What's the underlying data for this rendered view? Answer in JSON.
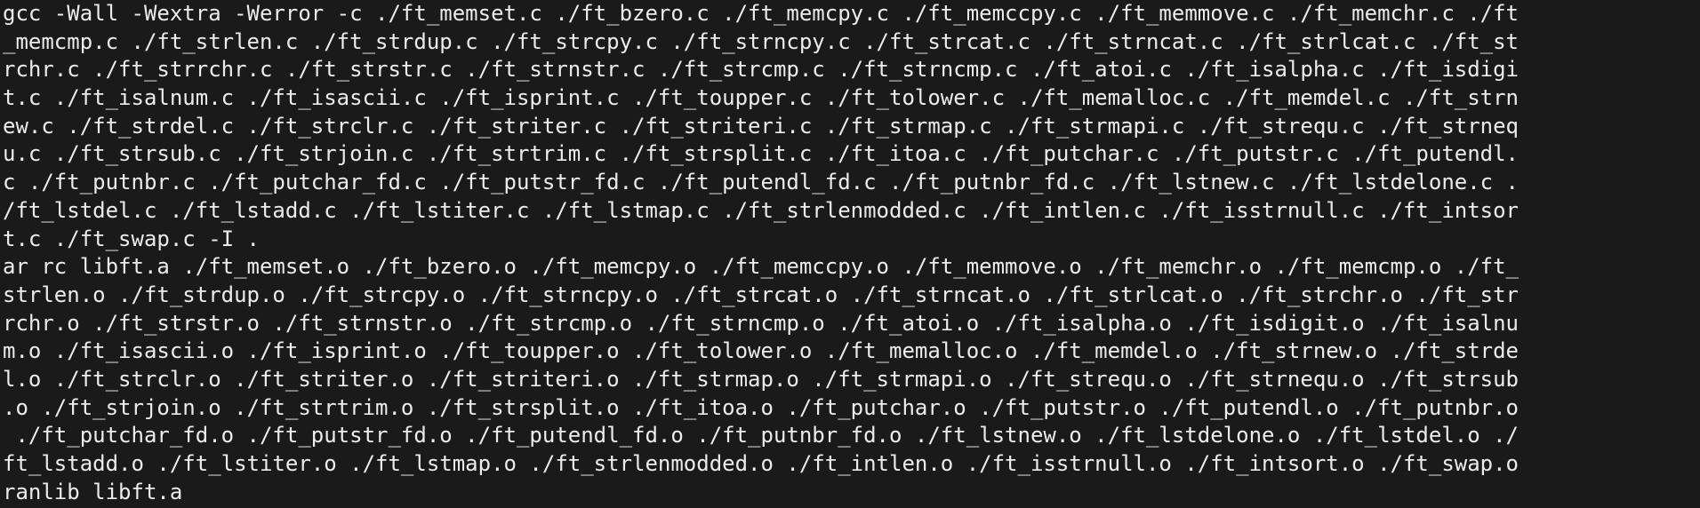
{
  "terminal": {
    "lines": [
      "gcc -Wall -Wextra -Werror -c ./ft_memset.c ./ft_bzero.c ./ft_memcpy.c ./ft_memccpy.c ./ft_memmove.c ./ft_memchr.c ./ft",
      "_memcmp.c ./ft_strlen.c ./ft_strdup.c ./ft_strcpy.c ./ft_strncpy.c ./ft_strcat.c ./ft_strncat.c ./ft_strlcat.c ./ft_st",
      "rchr.c ./ft_strrchr.c ./ft_strstr.c ./ft_strnstr.c ./ft_strcmp.c ./ft_strncmp.c ./ft_atoi.c ./ft_isalpha.c ./ft_isdigi",
      "t.c ./ft_isalnum.c ./ft_isascii.c ./ft_isprint.c ./ft_toupper.c ./ft_tolower.c ./ft_memalloc.c ./ft_memdel.c ./ft_strn",
      "ew.c ./ft_strdel.c ./ft_strclr.c ./ft_striter.c ./ft_striteri.c ./ft_strmap.c ./ft_strmapi.c ./ft_strequ.c ./ft_strneq",
      "u.c ./ft_strsub.c ./ft_strjoin.c ./ft_strtrim.c ./ft_strsplit.c ./ft_itoa.c ./ft_putchar.c ./ft_putstr.c ./ft_putendl.",
      "c ./ft_putnbr.c ./ft_putchar_fd.c ./ft_putstr_fd.c ./ft_putendl_fd.c ./ft_putnbr_fd.c ./ft_lstnew.c ./ft_lstdelone.c .",
      "/ft_lstdel.c ./ft_lstadd.c ./ft_lstiter.c ./ft_lstmap.c ./ft_strlenmodded.c ./ft_intlen.c ./ft_isstrnull.c ./ft_intsor",
      "t.c ./ft_swap.c -I .",
      "ar rc libft.a ./ft_memset.o ./ft_bzero.o ./ft_memcpy.o ./ft_memccpy.o ./ft_memmove.o ./ft_memchr.o ./ft_memcmp.o ./ft_",
      "strlen.o ./ft_strdup.o ./ft_strcpy.o ./ft_strncpy.o ./ft_strcat.o ./ft_strncat.o ./ft_strlcat.o ./ft_strchr.o ./ft_str",
      "rchr.o ./ft_strstr.o ./ft_strnstr.o ./ft_strcmp.o ./ft_strncmp.o ./ft_atoi.o ./ft_isalpha.o ./ft_isdigit.o ./ft_isalnu",
      "m.o ./ft_isascii.o ./ft_isprint.o ./ft_toupper.o ./ft_tolower.o ./ft_memalloc.o ./ft_memdel.o ./ft_strnew.o ./ft_strde",
      "l.o ./ft_strclr.o ./ft_striter.o ./ft_striteri.o ./ft_strmap.o ./ft_strmapi.o ./ft_strequ.o ./ft_strnequ.o ./ft_strsub",
      ".o ./ft_strjoin.o ./ft_strtrim.o ./ft_strsplit.o ./ft_itoa.o ./ft_putchar.o ./ft_putstr.o ./ft_putendl.o ./ft_putnbr.o",
      " ./ft_putchar_fd.o ./ft_putstr_fd.o ./ft_putendl_fd.o ./ft_putnbr_fd.o ./ft_lstnew.o ./ft_lstdelone.o ./ft_lstdel.o ./",
      "ft_lstadd.o ./ft_lstiter.o ./ft_lstmap.o ./ft_strlenmodded.o ./ft_intlen.o ./ft_isstrnull.o ./ft_intsort.o ./ft_swap.o",
      "ranlib libft.a"
    ]
  },
  "colors": {
    "background": "#1a1a1a",
    "foreground": "#ececec"
  }
}
